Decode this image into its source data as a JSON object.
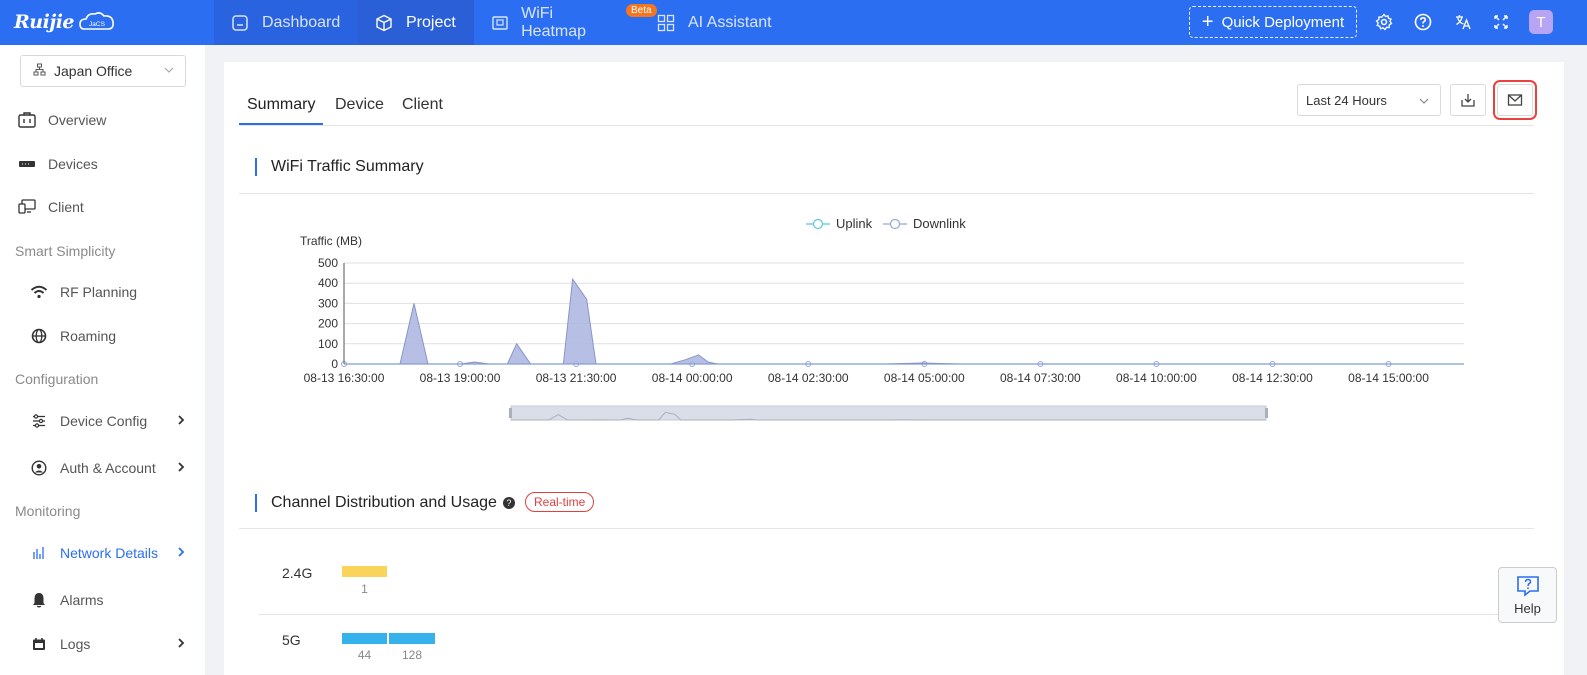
{
  "app": {
    "logo_text": "Ruijie",
    "logo_badge": "JaCS"
  },
  "topnav": {
    "items": [
      {
        "label": "Dashboard",
        "icon": "dashboard-icon"
      },
      {
        "label": "Project",
        "icon": "cube-icon"
      },
      {
        "label": "WiFi Heatmap",
        "icon": "heatmap-icon"
      },
      {
        "label": "AI Assistant",
        "icon": "grid-icon"
      }
    ],
    "beta_badge": "Beta",
    "quick_deployment": "Quick Deployment",
    "avatar_letter": "T"
  },
  "sidebar": {
    "site": "Japan Office",
    "items": [
      {
        "label": "Overview"
      },
      {
        "label": "Devices"
      },
      {
        "label": "Client"
      },
      {
        "section": "Smart Simplicity"
      },
      {
        "label": "RF Planning"
      },
      {
        "label": "Roaming"
      },
      {
        "section": "Configuration"
      },
      {
        "label": "Device Config"
      },
      {
        "label": "Auth & Account"
      },
      {
        "section": "Monitoring"
      },
      {
        "label": "Network Details"
      },
      {
        "label": "Alarms"
      },
      {
        "label": "Logs"
      }
    ]
  },
  "main": {
    "tabs": [
      "Summary",
      "Device",
      "Client"
    ],
    "range": "Last 24 Hours",
    "wifi_title": "WiFi Traffic Summary",
    "channel_title": "Channel Distribution and Usage",
    "realtime_badge": "Real-time",
    "bands": [
      {
        "label": "2.4G",
        "values": [
          1
        ],
        "color": "#fad45a"
      },
      {
        "label": "5G",
        "values": [
          44,
          128
        ],
        "color": "#35b2eb"
      }
    ]
  },
  "chart_data": {
    "type": "area",
    "ylabel": "Traffic (MB)",
    "ylim": [
      0,
      500
    ],
    "yticks": [
      0,
      100,
      200,
      300,
      400,
      500
    ],
    "xticks": [
      "08-13 16:30:00",
      "08-13 19:00:00",
      "08-13 21:30:00",
      "08-14 00:00:00",
      "08-14 02:30:00",
      "08-14 05:00:00",
      "08-14 07:30:00",
      "08-14 10:00:00",
      "08-14 12:30:00",
      "08-14 15:00:00"
    ],
    "legend": [
      "Uplink",
      "Downlink"
    ],
    "legend_position": "top-center",
    "grid": true,
    "series": [
      {
        "name": "Uplink",
        "color": "#5cc8d9",
        "values": [
          [
            0,
            0
          ],
          [
            5,
            0
          ],
          [
            10,
            0
          ],
          [
            12,
            0
          ],
          [
            15,
            0
          ],
          [
            20,
            0
          ],
          [
            25,
            0
          ],
          [
            30,
            0
          ],
          [
            35,
            0
          ],
          [
            40,
            0
          ],
          [
            45,
            0
          ],
          [
            50,
            0
          ],
          [
            55,
            0
          ],
          [
            60,
            0
          ],
          [
            65,
            0
          ],
          [
            70,
            0
          ],
          [
            75,
            0
          ],
          [
            80,
            0
          ],
          [
            85,
            0
          ],
          [
            90,
            0
          ],
          [
            95,
            0
          ],
          [
            100,
            0
          ],
          [
            105,
            0
          ],
          [
            110,
            0
          ],
          [
            115,
            0
          ],
          [
            120,
            0
          ]
        ]
      },
      {
        "name": "Downlink",
        "color": "#98a6d8",
        "values": [
          [
            0,
            0
          ],
          [
            5,
            0
          ],
          [
            6.0,
            0
          ],
          [
            7.5,
            300
          ],
          [
            9.0,
            0
          ],
          [
            12.5,
            0
          ],
          [
            14,
            10
          ],
          [
            15.5,
            0
          ],
          [
            17.5,
            0
          ],
          [
            18.5,
            100
          ],
          [
            20,
            0
          ],
          [
            22.5,
            0
          ],
          [
            23.5,
            0
          ],
          [
            24.5,
            420
          ],
          [
            26,
            320
          ],
          [
            27,
            0
          ],
          [
            35,
            0
          ],
          [
            36.5,
            20
          ],
          [
            38,
            45
          ],
          [
            39,
            10
          ],
          [
            40,
            0
          ],
          [
            50,
            0
          ],
          [
            58,
            0
          ],
          [
            62,
            5
          ],
          [
            66,
            0
          ],
          [
            120,
            0
          ]
        ]
      }
    ],
    "x_domain": [
      0,
      120
    ]
  },
  "help": {
    "label": "Help"
  }
}
